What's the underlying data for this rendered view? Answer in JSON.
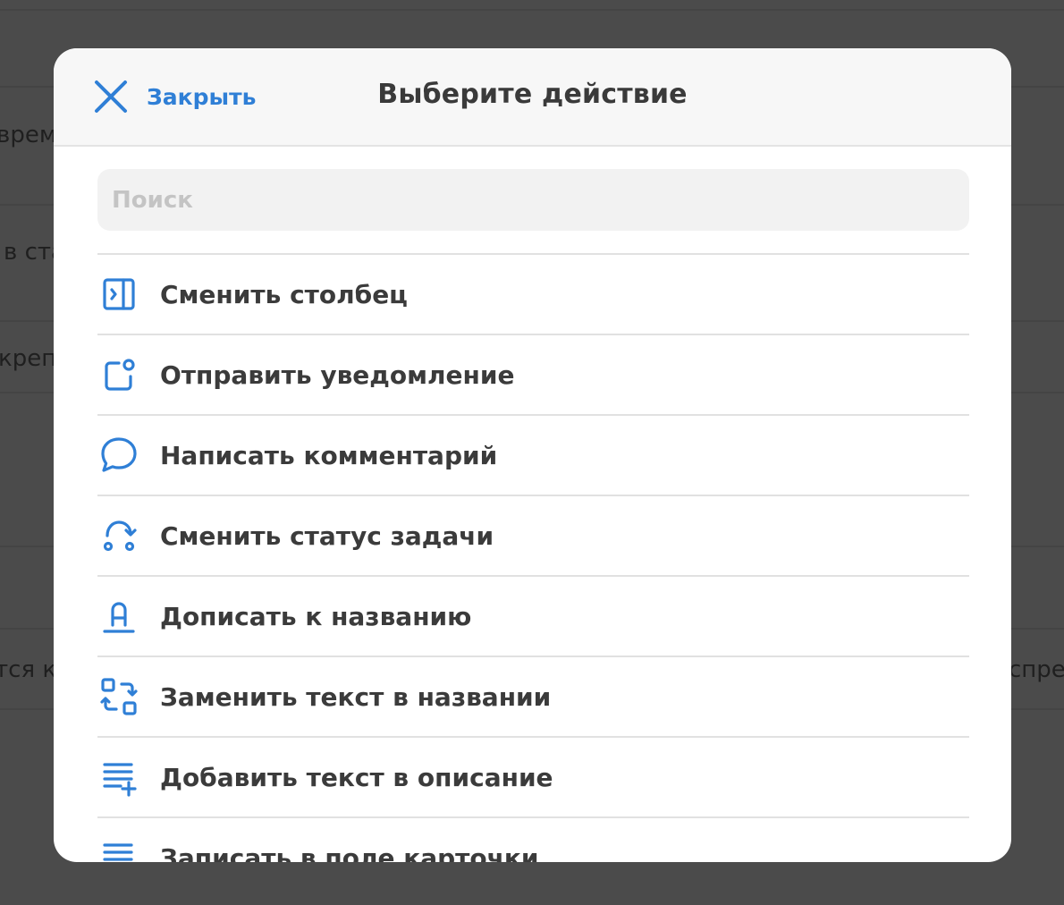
{
  "background": {
    "texts": [
      "време",
      "в ста",
      "крепл",
      "тся к",
      "спре"
    ]
  },
  "modal": {
    "close_label": "Закрыть",
    "title": "Выберите действие",
    "search_placeholder": "Поиск",
    "actions": [
      {
        "label": "Сменить столбец",
        "icon": "column-arrow-icon"
      },
      {
        "label": "Отправить уведомление",
        "icon": "notification-icon"
      },
      {
        "label": "Написать комментарий",
        "icon": "comment-bubble-icon"
      },
      {
        "label": "Сменить статус задачи",
        "icon": "status-change-icon"
      },
      {
        "label": "Дописать к названию",
        "icon": "text-underline-icon"
      },
      {
        "label": "Заменить текст в названии",
        "icon": "replace-text-icon"
      },
      {
        "label": "Добавить текст в описание",
        "icon": "add-lines-icon"
      },
      {
        "label": "Записать в поле карточки",
        "icon": "card-field-icon"
      }
    ]
  },
  "colors": {
    "accent": "#2f7fd6",
    "overlay": "#4b4b4b",
    "text": "#3b3b3b"
  }
}
